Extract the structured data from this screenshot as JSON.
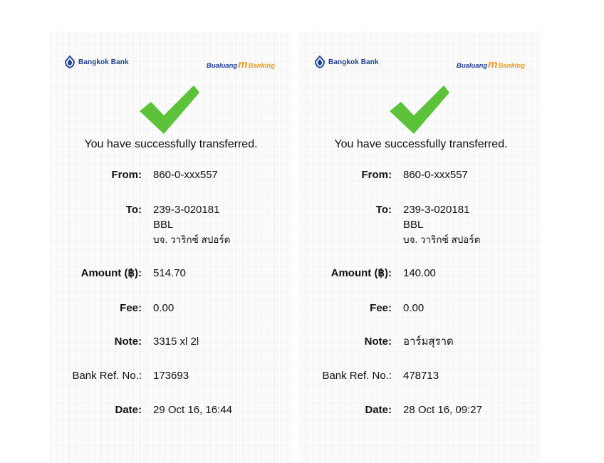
{
  "brand": {
    "bank_name": "Bangkok Bank",
    "app_logo_part1": "Bualuang",
    "app_logo_mark": "m",
    "app_logo_part2": "Banking",
    "primary_color": "#1d3f94",
    "accent_color": "#f39a21",
    "check_color": "#5cc23a"
  },
  "labels": {
    "success": "You have successfully transferred.",
    "from": "From:",
    "to": "To:",
    "amount": "Amount (฿):",
    "fee": "Fee:",
    "note": "Note:",
    "bank_ref": "Bank Ref. No.:",
    "date": "Date:"
  },
  "slips": [
    {
      "from_account": "860-0-xxx557",
      "to_account": "239-3-020181",
      "to_bank": "BBL",
      "to_name": "บจ. วาริกซ์ สปอร์ต",
      "amount": "514.70",
      "fee": "0.00",
      "note": "3315 xl 2l",
      "bank_ref": "173693",
      "date": "29 Oct 16, 16:44"
    },
    {
      "from_account": "860-0-xxx557",
      "to_account": "239-3-020181",
      "to_bank": "BBL",
      "to_name": "บจ. วาริกซ์ สปอร์ต",
      "amount": "140.00",
      "fee": "0.00",
      "note": "อาร์มสุราด",
      "bank_ref": "478713",
      "date": "28 Oct 16, 09:27"
    }
  ]
}
